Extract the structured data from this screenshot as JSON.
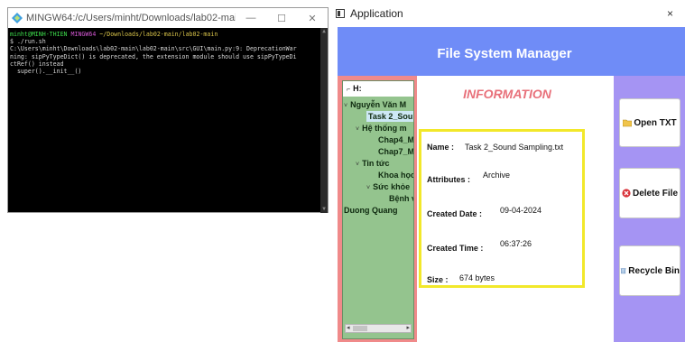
{
  "terminal": {
    "title": "MINGW64:/c/Users/minht/Downloads/lab02-main/lab0...",
    "controls": {
      "minimize": "—",
      "maximize": "☐",
      "close": "✕"
    },
    "prompt": {
      "user_host": "minht@MINH-THIEN",
      "shell": "MINGW64",
      "path": "~/Downloads/lab02-main/lab02-main"
    },
    "lines": [
      "$ ./run.sh",
      "C:\\Users\\minht\\Downloads\\lab02-main\\lab02-main\\src\\GUI\\main.py:9: DeprecationWar",
      "ning: sipPyTypeDict() is deprecated, the extension module should use sipPyTypeDi",
      "ctRef() instead",
      "  super().__init__()"
    ]
  },
  "app": {
    "title": "Application",
    "close": "×",
    "header_title": "File System Manager",
    "tree": {
      "root": "H:",
      "items": [
        {
          "label": "Nguyễn Văn M",
          "toggle": "˅"
        },
        {
          "label": "Task 2_Soun",
          "toggle": ""
        },
        {
          "label": "Hệ thống m",
          "toggle": "˅"
        },
        {
          "label": "Chap4_M",
          "toggle": ""
        },
        {
          "label": "Chap7_M",
          "toggle": ""
        },
        {
          "label": "Tin tức",
          "toggle": "˅"
        },
        {
          "label": "Khoa học",
          "toggle": ""
        },
        {
          "label": "Sức khỏe",
          "toggle": "˅"
        },
        {
          "label": "Bệnh v",
          "toggle": ""
        },
        {
          "label": "Duong Quang",
          "toggle": ""
        }
      ],
      "scroll_left": "◂",
      "scroll_right": "▸"
    },
    "info": {
      "title": "INFORMATION",
      "rows": [
        {
          "label": "Name :",
          "value": "Task 2_Sound Sampling.txt"
        },
        {
          "label": "Attributes :",
          "value": "Archive"
        },
        {
          "label": "Created Date :",
          "value": "09-04-2024"
        },
        {
          "label": "Created Time :",
          "value": "06:37:26"
        },
        {
          "label": "Size :",
          "value": "674 bytes"
        }
      ]
    },
    "actions": [
      {
        "label": "Open TXT",
        "icon": "folder-icon"
      },
      {
        "label": "Delete File",
        "icon": "delete-icon"
      },
      {
        "label": "Recycle Bin",
        "icon": "recycle-bin-icon"
      }
    ]
  }
}
